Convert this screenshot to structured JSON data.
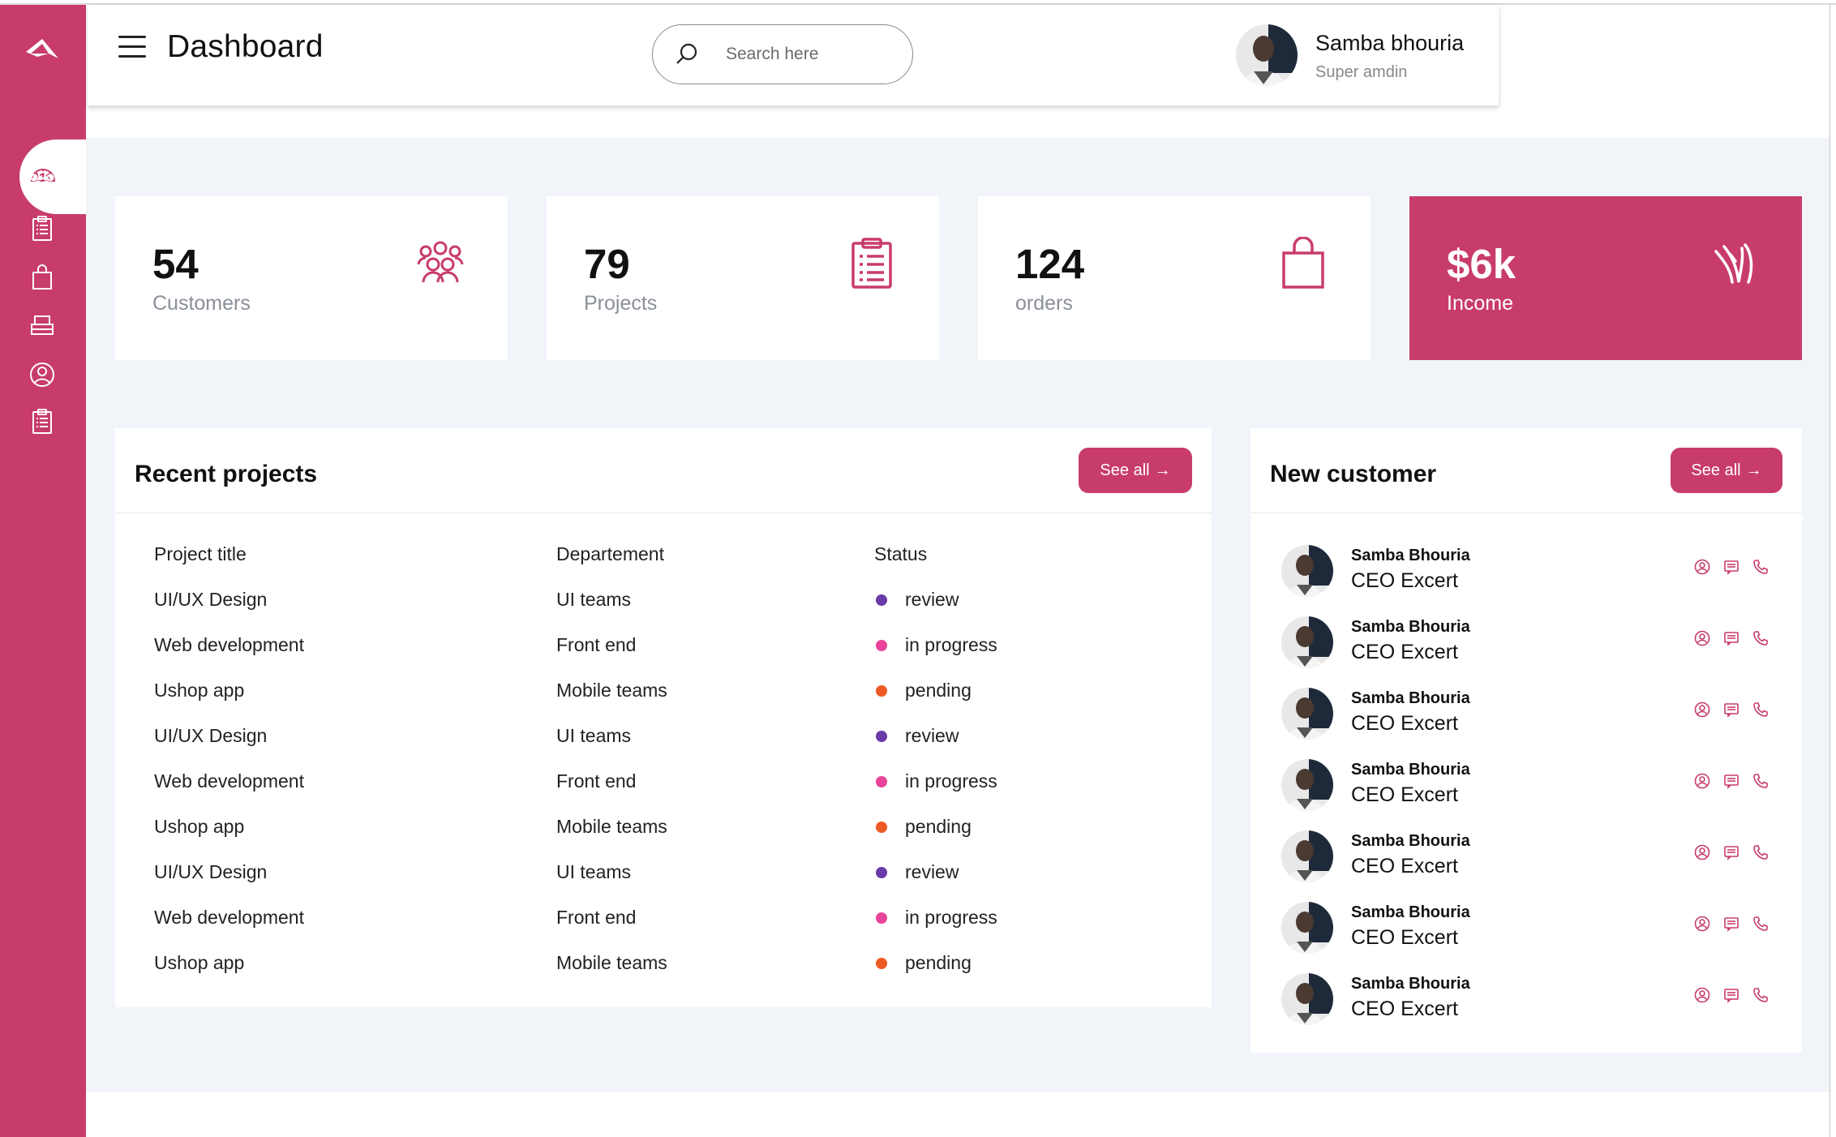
{
  "header": {
    "title": "Dashboard",
    "search_placeholder": "Search here",
    "user_name": "Samba bhouria",
    "user_role": "Super amdin"
  },
  "sidebar": {
    "items": [
      {
        "icon": "dashboard-icon",
        "active": true
      },
      {
        "icon": "customers-icon"
      },
      {
        "icon": "projects-icon"
      },
      {
        "icon": "orders-icon"
      },
      {
        "icon": "inventory-icon"
      },
      {
        "icon": "account-icon"
      },
      {
        "icon": "tasks-icon"
      }
    ]
  },
  "stats": [
    {
      "value": "54",
      "label": "Customers",
      "icon": "customers-icon"
    },
    {
      "value": "79",
      "label": "Projects",
      "icon": "clipboard-icon"
    },
    {
      "value": "124",
      "label": "orders",
      "icon": "shopping-bag-icon"
    },
    {
      "value": "$6k",
      "label": "Income",
      "icon": "income-icon"
    }
  ],
  "recent_projects": {
    "title": "Recent projects",
    "see_all": "See all",
    "columns": [
      "Project title",
      "Departement",
      "Status"
    ],
    "rows": [
      {
        "title": "UI/UX Design",
        "dept": "UI teams",
        "status": "review"
      },
      {
        "title": "Web development",
        "dept": "Front end",
        "status": "in progress"
      },
      {
        "title": "Ushop app",
        "dept": "Mobile teams",
        "status": "pending"
      },
      {
        "title": "UI/UX Design",
        "dept": "UI teams",
        "status": "review"
      },
      {
        "title": "Web development",
        "dept": "Front end",
        "status": "in progress"
      },
      {
        "title": "Ushop app",
        "dept": "Mobile teams",
        "status": "pending"
      },
      {
        "title": "UI/UX Design",
        "dept": "UI teams",
        "status": "review"
      },
      {
        "title": "Web development",
        "dept": "Front end",
        "status": "in progress"
      },
      {
        "title": "Ushop app",
        "dept": "Mobile teams",
        "status": "pending"
      }
    ]
  },
  "status_colors": {
    "review": "#6a3aa8",
    "in progress": "#e8449a",
    "pending": "#ee5a24"
  },
  "new_customer": {
    "title": "New customer",
    "see_all": "See all",
    "rows": [
      {
        "name": "Samba Bhouria",
        "title": "CEO Excert"
      },
      {
        "name": "Samba Bhouria",
        "title": "CEO Excert"
      },
      {
        "name": "Samba Bhouria",
        "title": "CEO Excert"
      },
      {
        "name": "Samba Bhouria",
        "title": "CEO Excert"
      },
      {
        "name": "Samba Bhouria",
        "title": "CEO Excert"
      },
      {
        "name": "Samba Bhouria",
        "title": "CEO Excert"
      },
      {
        "name": "Samba Bhouria",
        "title": "CEO Excert"
      }
    ]
  },
  "colors": {
    "accent": "#c83c6b",
    "background": "#f1f4f9"
  }
}
